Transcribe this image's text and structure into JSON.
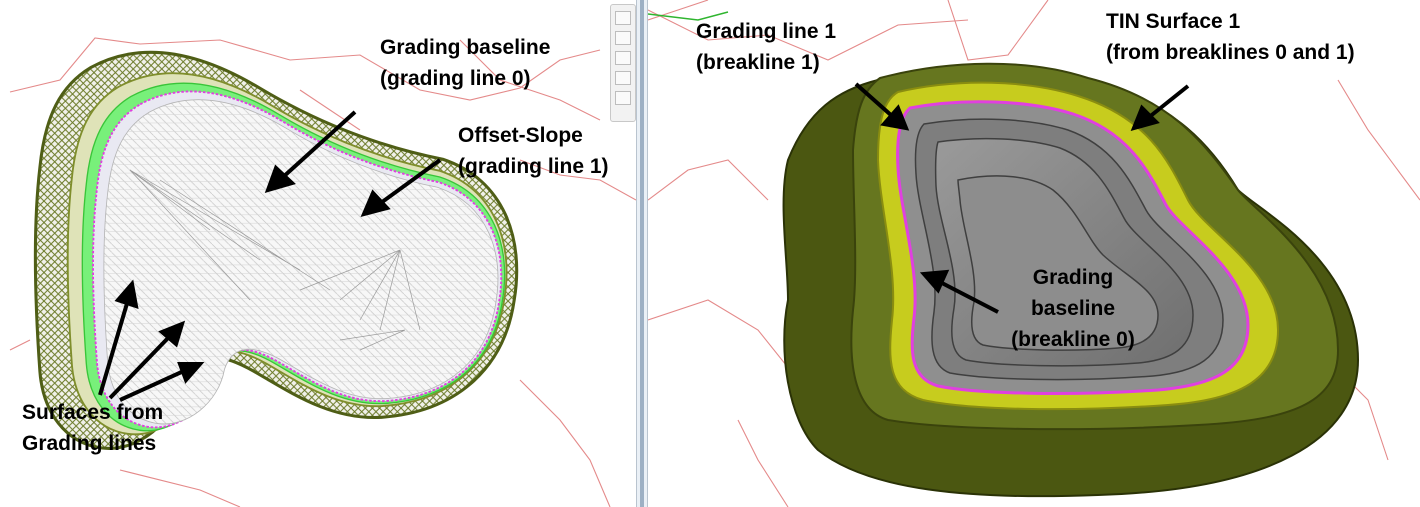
{
  "left_view": {
    "labels": {
      "grading_baseline": [
        "Grading baseline",
        "(grading line 0)"
      ],
      "offset_slope": [
        "Offset-Slope",
        "(grading line 1)"
      ],
      "surfaces": [
        "Surfaces from",
        "Grading lines"
      ]
    }
  },
  "right_view": {
    "labels": {
      "grading_line_1": [
        "Grading line 1",
        "(breakline 1)"
      ],
      "tin_surface": [
        "TIN Surface 1",
        "(from breaklines 0 and 1)"
      ],
      "grading_baseline": [
        "Grading",
        "baseline",
        "(breakline 0)"
      ]
    }
  },
  "colors": {
    "outer_band": "#5c6b1c",
    "yellow_band": "#c7cc1e",
    "green_band": "#4cf04c",
    "baseline": "#e040e0",
    "contour": "#e48a8a",
    "pit_grey": "#8a8a8a"
  },
  "icons": [
    "navigation-bar-icon",
    "arrow-icon"
  ]
}
